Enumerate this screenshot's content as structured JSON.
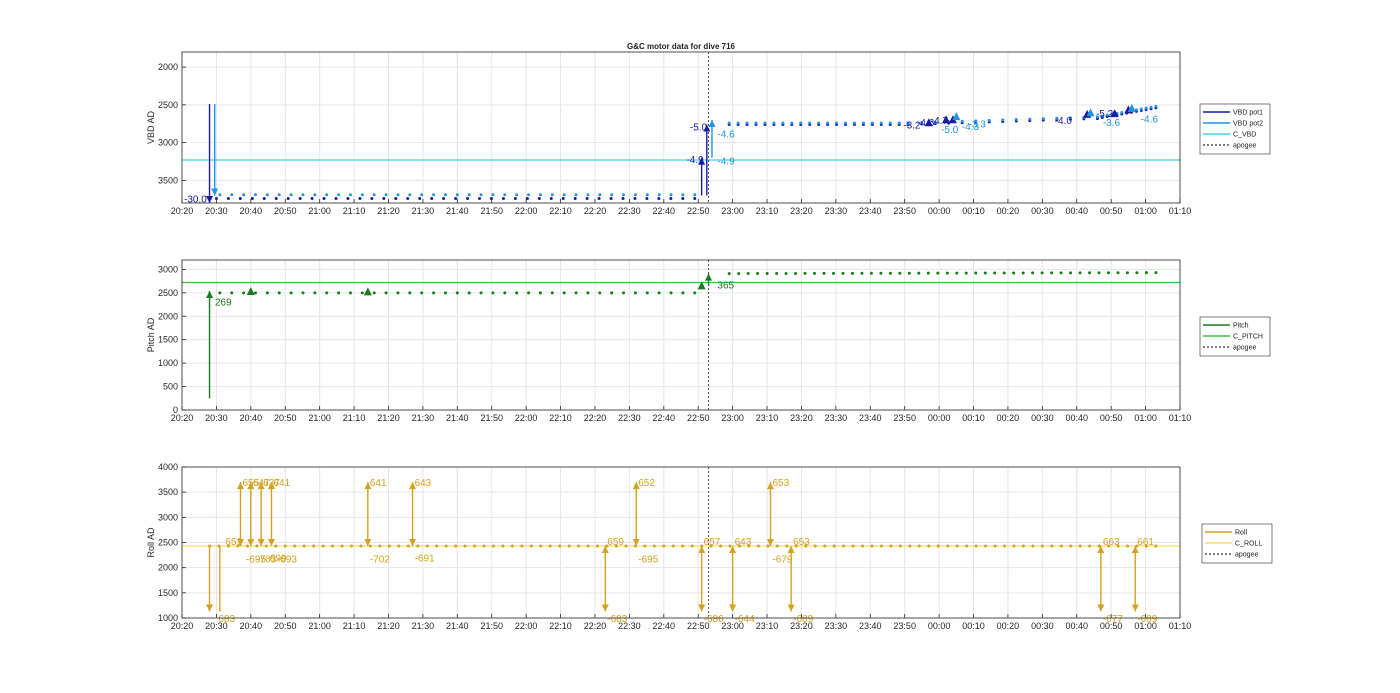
{
  "figure_title": "G&C motor data for dive 716",
  "chart_data": [
    {
      "type": "line",
      "ylabel": "VBD AD",
      "ylim": [
        3800,
        1800
      ],
      "y_reversed": true,
      "yticks": [
        2000,
        2500,
        3000,
        3500
      ],
      "xlim": [
        "20:20",
        "01:10"
      ],
      "xticks": [
        "20:20",
        "20:30",
        "20:40",
        "20:50",
        "21:00",
        "21:10",
        "21:20",
        "21:30",
        "21:40",
        "21:50",
        "22:00",
        "22:10",
        "22:20",
        "22:30",
        "22:40",
        "22:50",
        "23:00",
        "23:10",
        "23:20",
        "23:30",
        "23:40",
        "23:50",
        "00:00",
        "00:10",
        "00:20",
        "00:30",
        "00:40",
        "00:50",
        "01:00",
        "01:10"
      ],
      "grid": true,
      "legend_position": "right",
      "legend": [
        "VBD pot1",
        "VBD pot2",
        "C_VBD",
        "apogee"
      ],
      "colors": {
        "pot1": "#1a1aa8",
        "pot2": "#2196e0",
        "c_line": "#41d2e8",
        "apogee": "#555555"
      },
      "c_value": 3230,
      "apogee": "22:53",
      "series": [
        {
          "name": "VBD pot1",
          "segments": [
            [
              "20:30",
              3740,
              "22:49",
              3740,
              40
            ],
            [
              "22:59",
              2760,
              "23:51",
              2760,
              20
            ],
            [
              "23:51",
              2760,
              "00:46",
              2680,
              14
            ],
            [
              "00:46",
              2680,
              "01:03",
              2540,
              12
            ]
          ]
        },
        {
          "name": "VBD pot2",
          "segments": [
            [
              "20:31",
              3690,
              "22:49",
              3690,
              40
            ],
            [
              "22:59",
              2740,
              "23:51",
              2740,
              20
            ],
            [
              "23:51",
              2740,
              "00:46",
              2660,
              14
            ],
            [
              "00:46",
              2660,
              "01:03",
              2520,
              12
            ]
          ]
        }
      ],
      "arrows": [
        {
          "x": "20:28",
          "y1": 2490,
          "y2": 3800,
          "color": "pot1",
          "dir": "down"
        },
        {
          "x": "20:29.5",
          "y1": 2490,
          "y2": 3700,
          "color": "pot2",
          "dir": "down"
        },
        {
          "x": "22:51",
          "y1": 3700,
          "y2": 3200,
          "color": "pot1",
          "dir": "up"
        },
        {
          "x": "22:52.5",
          "y1": 3700,
          "y2": 2760,
          "color": "pot1",
          "dir": "up"
        },
        {
          "x": "22:54",
          "y1": 3200,
          "y2": 2700,
          "color": "pot2",
          "dir": "up"
        }
      ],
      "markers": [
        {
          "x": "23:57",
          "y": 2730,
          "color": "pot1"
        },
        {
          "x": "00:02",
          "y": 2690,
          "color": "pot1"
        },
        {
          "x": "00:04",
          "y": 2690,
          "color": "pot1"
        },
        {
          "x": "00:05",
          "y": 2650,
          "color": "pot2"
        },
        {
          "x": "00:43",
          "y": 2620,
          "color": "pot1"
        },
        {
          "x": "00:44",
          "y": 2600,
          "color": "pot2"
        },
        {
          "x": "00:51",
          "y": 2610,
          "color": "pot1"
        },
        {
          "x": "00:55",
          "y": 2560,
          "color": "pot1"
        },
        {
          "x": "00:56",
          "y": 2540,
          "color": "pot2"
        }
      ],
      "annotations": [
        {
          "text": "-30.0",
          "x": "20:20",
          "y": 3740,
          "color": "pot1"
        },
        {
          "text": "-5.0",
          "x": "22:47",
          "y": 2790,
          "color": "pot1"
        },
        {
          "text": "-4.6",
          "x": "22:55",
          "y": 2880,
          "color": "pot2"
        },
        {
          "text": "-4.9",
          "x": "22:46",
          "y": 3220,
          "color": "pot1"
        },
        {
          "text": "-4.9",
          "x": "22:55",
          "y": 3240,
          "color": "pot2"
        },
        {
          "text": "-3.2",
          "x": "23:49",
          "y": 2760,
          "color": "pot1"
        },
        {
          "text": "-4.6",
          "x": "23:53",
          "y": 2730,
          "color": "pot1"
        },
        {
          "text": "-4.7",
          "x": "23:57",
          "y": 2700,
          "color": "pot1"
        },
        {
          "text": "-5.0",
          "x": "00:00",
          "y": 2820,
          "color": "pot2"
        },
        {
          "text": "-4.3",
          "x": "00:06",
          "y": 2780,
          "color": "pot2"
        },
        {
          "text": "-3.3",
          "x": "00:08",
          "y": 2750,
          "color": "pot2"
        },
        {
          "text": "-4.0",
          "x": "00:33",
          "y": 2700,
          "color": "pot1"
        },
        {
          "text": "-5.2",
          "x": "00:45",
          "y": 2610,
          "color": "pot1"
        },
        {
          "text": "-3.6",
          "x": "00:47",
          "y": 2730,
          "color": "pot2"
        },
        {
          "text": "-4.6",
          "x": "00:58",
          "y": 2680,
          "color": "pot2"
        }
      ]
    },
    {
      "type": "line",
      "ylabel": "Pitch AD",
      "ylim": [
        0,
        3200
      ],
      "yticks": [
        0,
        500,
        1000,
        1500,
        2000,
        2500,
        3000
      ],
      "xlim": [
        "20:20",
        "01:10"
      ],
      "xticks": [
        "20:20",
        "20:30",
        "20:40",
        "20:50",
        "21:00",
        "21:10",
        "21:20",
        "21:30",
        "21:40",
        "21:50",
        "22:00",
        "22:10",
        "22:20",
        "22:30",
        "22:40",
        "22:50",
        "23:00",
        "23:10",
        "23:20",
        "23:30",
        "23:40",
        "23:50",
        "00:00",
        "00:10",
        "00:20",
        "00:30",
        "00:40",
        "00:50",
        "01:00",
        "01:10"
      ],
      "grid": true,
      "legend_position": "right",
      "legend": [
        "Pitch",
        "C_PITCH",
        "apogee"
      ],
      "colors": {
        "main": "#1b7a1b",
        "c_line": "#3fbf3f",
        "apogee": "#555555"
      },
      "c_value": 2720,
      "apogee": "22:53",
      "series": [
        {
          "name": "Pitch",
          "segments": [
            [
              "20:31",
              2500,
              "22:49",
              2500,
              40
            ],
            [
              "22:59",
              2910,
              "01:03",
              2930,
              45
            ]
          ]
        }
      ],
      "arrows": [
        {
          "x": "20:28",
          "y1": 250,
          "y2": 2540,
          "color": "main",
          "dir": "up"
        },
        {
          "x": "22:53",
          "y1": 2650,
          "y2": 2910,
          "color": "main",
          "dir": "up"
        }
      ],
      "markers": [
        {
          "x": "20:40",
          "y": 2540,
          "color": "main"
        },
        {
          "x": "21:14",
          "y": 2530,
          "color": "main"
        },
        {
          "x": "22:51",
          "y": 2660,
          "color": "main"
        }
      ],
      "annotations": [
        {
          "text": "269",
          "x": "20:29",
          "y": 2310,
          "color": "main"
        },
        {
          "text": "365",
          "x": "22:55",
          "y": 2680,
          "color": "main"
        }
      ]
    },
    {
      "type": "line",
      "ylabel": "Roll AD",
      "ylim": [
        1000,
        4000
      ],
      "yticks": [
        1000,
        1500,
        2000,
        2500,
        3000,
        3500,
        4000
      ],
      "xlim": [
        "20:20",
        "01:10"
      ],
      "xticks": [
        "20:20",
        "20:30",
        "20:40",
        "20:50",
        "21:00",
        "21:10",
        "21:20",
        "21:30",
        "21:40",
        "21:50",
        "22:00",
        "22:10",
        "22:20",
        "22:30",
        "22:40",
        "22:50",
        "23:00",
        "23:10",
        "23:20",
        "23:30",
        "23:40",
        "23:50",
        "00:00",
        "00:10",
        "00:20",
        "00:30",
        "00:40",
        "00:50",
        "01:00",
        "01:10"
      ],
      "grid": true,
      "legend_position": "right",
      "legend": [
        "Roll",
        "C_ROLL",
        "apogee"
      ],
      "colors": {
        "main": "#d4a21f",
        "c_line": "#f0e060",
        "apogee": "#555555"
      },
      "c_value": 2430,
      "apogee": "22:53",
      "series": [
        {
          "name": "Roll",
          "segments": [
            [
              "20:28",
              2430,
              "01:03",
              2430,
              100
            ]
          ]
        }
      ],
      "arrows": [
        {
          "x": "20:28",
          "y1": 2430,
          "y2": 1130,
          "color": "main",
          "dir": "down"
        },
        {
          "x": "20:31",
          "y1": 2430,
          "y2": 1130,
          "color": "main",
          "dir": "none"
        },
        {
          "x": "20:37",
          "y1": 2430,
          "y2": 3700,
          "color": "main",
          "dir": "updown"
        },
        {
          "x": "20:40",
          "y1": 2430,
          "y2": 3700,
          "color": "main",
          "dir": "updown"
        },
        {
          "x": "20:43",
          "y1": 2430,
          "y2": 3700,
          "color": "main",
          "dir": "updown"
        },
        {
          "x": "20:46",
          "y1": 2430,
          "y2": 3700,
          "color": "main",
          "dir": "updown"
        },
        {
          "x": "21:14",
          "y1": 2430,
          "y2": 3700,
          "color": "main",
          "dir": "updown"
        },
        {
          "x": "21:27",
          "y1": 2430,
          "y2": 3700,
          "color": "main",
          "dir": "updown"
        },
        {
          "x": "22:23",
          "y1": 2430,
          "y2": 1130,
          "color": "main",
          "dir": "updown"
        },
        {
          "x": "22:32",
          "y1": 2430,
          "y2": 3700,
          "color": "main",
          "dir": "updown"
        },
        {
          "x": "22:51",
          "y1": 2430,
          "y2": 1130,
          "color": "main",
          "dir": "updown"
        },
        {
          "x": "23:00",
          "y1": 2430,
          "y2": 1130,
          "color": "main",
          "dir": "updown"
        },
        {
          "x": "23:11",
          "y1": 2430,
          "y2": 3700,
          "color": "main",
          "dir": "updown"
        },
        {
          "x": "23:17",
          "y1": 2430,
          "y2": 1130,
          "color": "main",
          "dir": "updown"
        },
        {
          "x": "00:47",
          "y1": 2430,
          "y2": 1130,
          "color": "main",
          "dir": "updown"
        },
        {
          "x": "00:57",
          "y1": 2430,
          "y2": 1130,
          "color": "main",
          "dir": "updown"
        }
      ],
      "markers": [],
      "annotations": [
        {
          "text": "651",
          "x": "20:32",
          "y": 2530,
          "color": "main"
        },
        {
          "text": "683",
          "x": "20:30",
          "y": 1000,
          "color": "main"
        },
        {
          "text": "655",
          "x": "20:37",
          "y": 3700,
          "color": "main"
        },
        {
          "text": "647",
          "x": "20:40",
          "y": 3700,
          "color": "main"
        },
        {
          "text": "637",
          "x": "20:43",
          "y": 3700,
          "color": "main"
        },
        {
          "text": "641",
          "x": "20:46",
          "y": 3700,
          "color": "main"
        },
        {
          "text": "-695",
          "x": "20:38",
          "y": 2180,
          "color": "main"
        },
        {
          "text": "-703",
          "x": "20:41",
          "y": 2180,
          "color": "main"
        },
        {
          "text": "-699",
          "x": "20:44",
          "y": 2200,
          "color": "main"
        },
        {
          "text": "-693",
          "x": "20:47",
          "y": 2180,
          "color": "main"
        },
        {
          "text": "641",
          "x": "21:14",
          "y": 3700,
          "color": "main"
        },
        {
          "text": "-702",
          "x": "21:14",
          "y": 2180,
          "color": "main"
        },
        {
          "text": "643",
          "x": "21:27",
          "y": 3700,
          "color": "main"
        },
        {
          "text": "-691",
          "x": "21:27",
          "y": 2200,
          "color": "main"
        },
        {
          "text": "659",
          "x": "22:23",
          "y": 2530,
          "color": "main"
        },
        {
          "text": "-683",
          "x": "22:23",
          "y": 1000,
          "color": "main"
        },
        {
          "text": "652",
          "x": "22:32",
          "y": 3700,
          "color": "main"
        },
        {
          "text": "-695",
          "x": "22:32",
          "y": 2180,
          "color": "main"
        },
        {
          "text": "657",
          "x": "22:51",
          "y": 2530,
          "color": "main"
        },
        {
          "text": "-686",
          "x": "22:51",
          "y": 1000,
          "color": "main"
        },
        {
          "text": "643",
          "x": "23:00",
          "y": 2530,
          "color": "main"
        },
        {
          "text": "-644",
          "x": "23:00",
          "y": 1000,
          "color": "main"
        },
        {
          "text": "653",
          "x": "23:11",
          "y": 3700,
          "color": "main"
        },
        {
          "text": "-679",
          "x": "23:11",
          "y": 2180,
          "color": "main"
        },
        {
          "text": "653",
          "x": "23:17",
          "y": 2530,
          "color": "main"
        },
        {
          "text": "-689",
          "x": "23:17",
          "y": 1000,
          "color": "main"
        },
        {
          "text": "663",
          "x": "00:47",
          "y": 2530,
          "color": "main"
        },
        {
          "text": "-677",
          "x": "00:47",
          "y": 1000,
          "color": "main"
        },
        {
          "text": "661",
          "x": "00:57",
          "y": 2530,
          "color": "main"
        },
        {
          "text": "-689",
          "x": "00:57",
          "y": 1000,
          "color": "main"
        }
      ]
    }
  ]
}
